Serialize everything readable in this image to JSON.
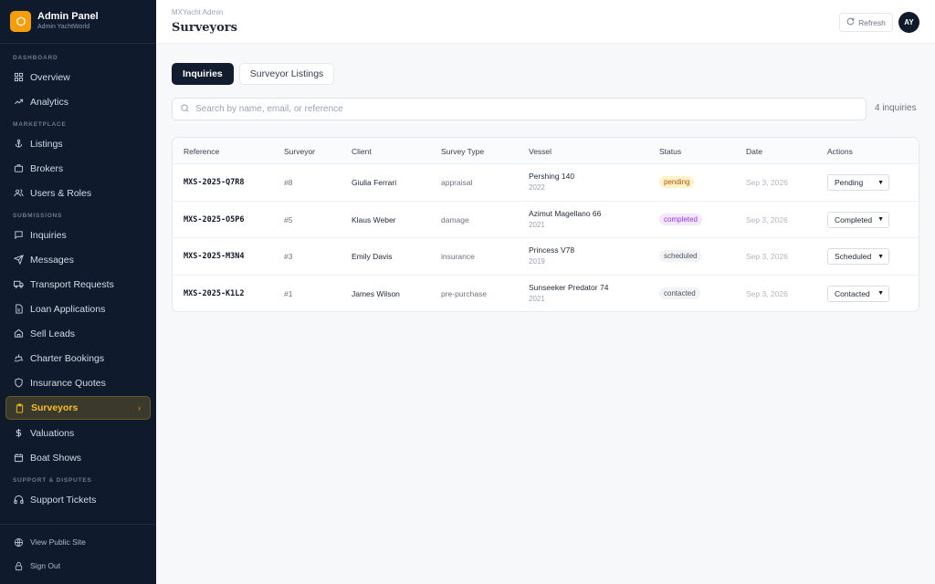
{
  "brand": {
    "title": "Admin Panel",
    "subtitle": "Admin YachtWorld"
  },
  "sidebar": {
    "sections": [
      {
        "label": "DASHBOARD",
        "items": [
          {
            "label": "Overview",
            "icon": "grid-icon"
          },
          {
            "label": "Analytics",
            "icon": "trending-up-icon"
          }
        ]
      },
      {
        "label": "MARKETPLACE",
        "items": [
          {
            "label": "Listings",
            "icon": "anchor-icon"
          },
          {
            "label": "Brokers",
            "icon": "briefcase-icon"
          },
          {
            "label": "Users & Roles",
            "icon": "users-icon"
          }
        ]
      },
      {
        "label": "SUBMISSIONS",
        "items": [
          {
            "label": "Inquiries",
            "icon": "message-square-icon"
          },
          {
            "label": "Messages",
            "icon": "send-icon"
          },
          {
            "label": "Transport Requests",
            "icon": "truck-icon"
          },
          {
            "label": "Loan Applications",
            "icon": "file-icon"
          },
          {
            "label": "Sell Leads",
            "icon": "home-icon"
          },
          {
            "label": "Charter Bookings",
            "icon": "ship-icon"
          },
          {
            "label": "Insurance Quotes",
            "icon": "shield-icon"
          },
          {
            "label": "Surveyors",
            "icon": "clipboard-icon",
            "active": true
          },
          {
            "label": "Valuations",
            "icon": "dollar-icon"
          },
          {
            "label": "Boat Shows",
            "icon": "calendar-icon"
          }
        ]
      },
      {
        "label": "SUPPORT & DISPUTES",
        "items": [
          {
            "label": "Support Tickets",
            "icon": "headphones-icon"
          }
        ]
      }
    ],
    "bottom": [
      {
        "label": "View Public Site",
        "icon": "globe-icon"
      },
      {
        "label": "Sign Out",
        "icon": "lock-icon"
      }
    ]
  },
  "header": {
    "breadcrumb": "MXYacht Admin",
    "title": "Surveyors",
    "refresh_label": "Refresh",
    "avatar_initials": "AY"
  },
  "tabs": [
    {
      "label": "Inquiries",
      "active": true
    },
    {
      "label": "Surveyor Listings",
      "active": false
    }
  ],
  "search": {
    "placeholder": "Search by name, email, or reference",
    "value": ""
  },
  "count_label": "4 inquiries",
  "table": {
    "columns": [
      "Reference",
      "Surveyor",
      "Client",
      "Survey Type",
      "Vessel",
      "Status",
      "Date",
      "Actions"
    ],
    "rows": [
      {
        "reference": "MXS-2025-Q7R8",
        "surveyor": "#8",
        "client": "Giulia Ferrari",
        "survey_type": "appraisal",
        "vessel": "Pershing 140",
        "year": "2022",
        "status": "pending",
        "date": "Sep 3, 2026",
        "action": "Pending"
      },
      {
        "reference": "MXS-2025-O5P6",
        "surveyor": "#5",
        "client": "Klaus Weber",
        "survey_type": "damage",
        "vessel": "Azimut Magellano 66",
        "year": "2021",
        "status": "completed",
        "date": "Sep 3, 2026",
        "action": "Completed"
      },
      {
        "reference": "MXS-2025-M3N4",
        "surveyor": "#3",
        "client": "Emily Davis",
        "survey_type": "insurance",
        "vessel": "Princess V78",
        "year": "2019",
        "status": "scheduled",
        "date": "Sep 3, 2026",
        "action": "Scheduled"
      },
      {
        "reference": "MXS-2025-K1L2",
        "surveyor": "#1",
        "client": "James Wilson",
        "survey_type": "pre-purchase",
        "vessel": "Sunseeker Predator 74",
        "year": "2021",
        "status": "contacted",
        "date": "Sep 3, 2026",
        "action": "Contacted"
      }
    ]
  },
  "colors": {
    "sidebar_bg": "#0f1b2d",
    "accent": "#f59e0b",
    "active_text": "#fbbf24"
  }
}
